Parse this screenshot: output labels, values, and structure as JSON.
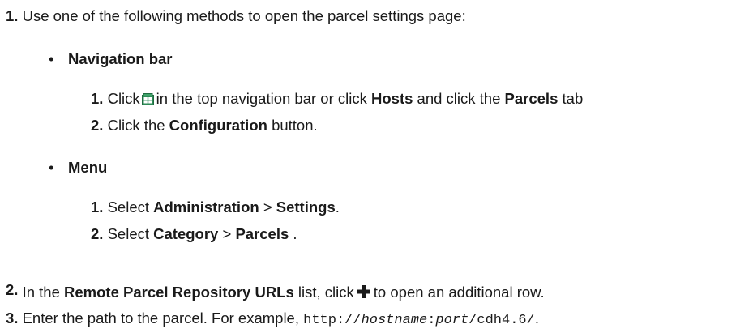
{
  "step1": {
    "number": "1.",
    "text": "Use one of the following methods to open the parcel settings page:"
  },
  "nav": {
    "bullet": "•",
    "title": "Navigation bar",
    "sub1": {
      "number": "1.",
      "pre": "Click",
      "mid1": "in the top navigation bar or click",
      "hosts": "Hosts",
      "mid2": "and click the",
      "parcels": "Parcels",
      "post": "tab"
    },
    "sub2": {
      "number": "2.",
      "pre": "Click the",
      "configuration": "Configuration",
      "post": "button."
    }
  },
  "menu": {
    "bullet": "•",
    "title": "Menu",
    "sub1": {
      "number": "1.",
      "pre": "Select",
      "administration": "Administration",
      "sep": ">",
      "settings": "Settings",
      "post": "."
    },
    "sub2": {
      "number": "2.",
      "pre": "Select",
      "category": "Category",
      "sep": ">",
      "parcels": "Parcels",
      "post": "."
    }
  },
  "step2": {
    "number": "2.",
    "pre": "In the",
    "list_name": "Remote Parcel Repository URLs",
    "mid": "list, click",
    "post": "to open an additional row."
  },
  "step3": {
    "number": "3.",
    "pre": "Enter the path to the parcel. For example,",
    "url_prefix": "http://",
    "url_host": "hostname",
    "url_colon": ":",
    "url_port": "port",
    "url_suffix": "/cdh4.6/",
    "post": "."
  },
  "icons": {
    "parcel": "parcel-icon",
    "plus": "plus-icon"
  },
  "colors": {
    "text": "#1a1a1a",
    "parcel_icon_fill": "#2e8b57",
    "parcel_icon_light": "#ffffff"
  }
}
